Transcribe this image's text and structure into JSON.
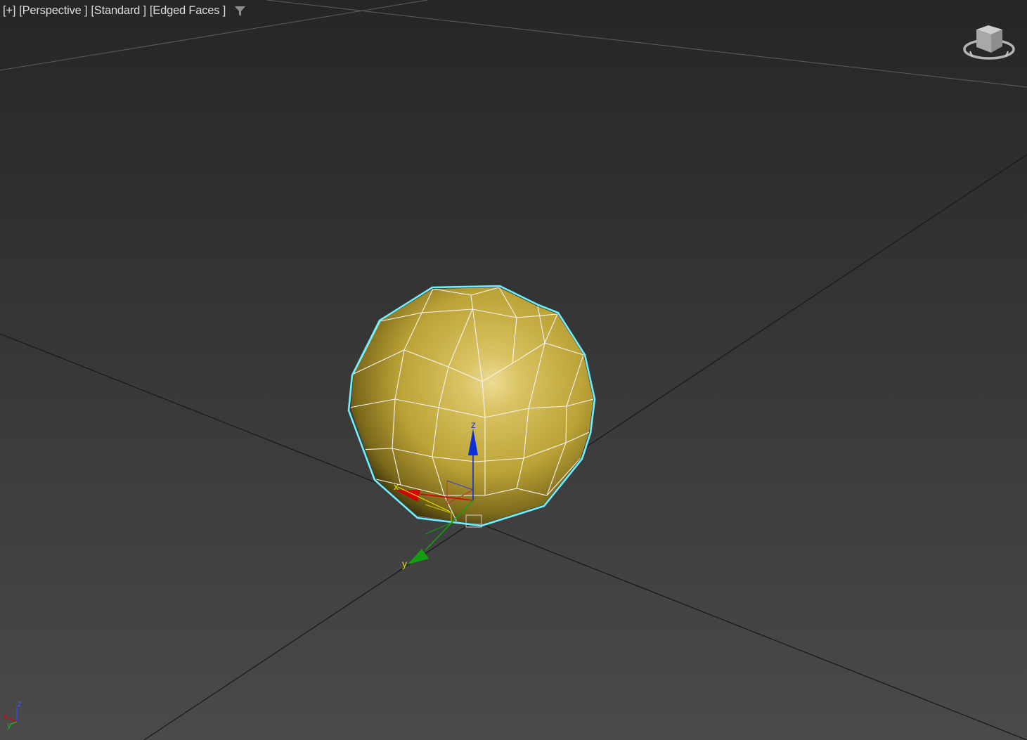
{
  "viewport": {
    "labels": {
      "menu": "[+]",
      "view": "[Perspective ]",
      "shading": "[Standard ]",
      "display": "[Edged Faces ]"
    },
    "icons": {
      "filter": "funnel-filter-icon",
      "viewcube": "viewcube-icon",
      "orbit": "orbit-ring-icon"
    },
    "gizmo": {
      "x_label": "x",
      "y_label": "y",
      "z_label": "z"
    },
    "world_axis": {
      "x_label": "x",
      "y_label": "y",
      "z_label": "z"
    },
    "colors": {
      "background_top": "#262626",
      "background_bottom": "#4a4a4a",
      "sphere": "#c9b246",
      "selection": "#6ff0ff",
      "axis_x": "#d40000",
      "axis_y": "#12a012",
      "axis_z": "#0b2fd8",
      "label_text": "#dcdcdc"
    }
  }
}
